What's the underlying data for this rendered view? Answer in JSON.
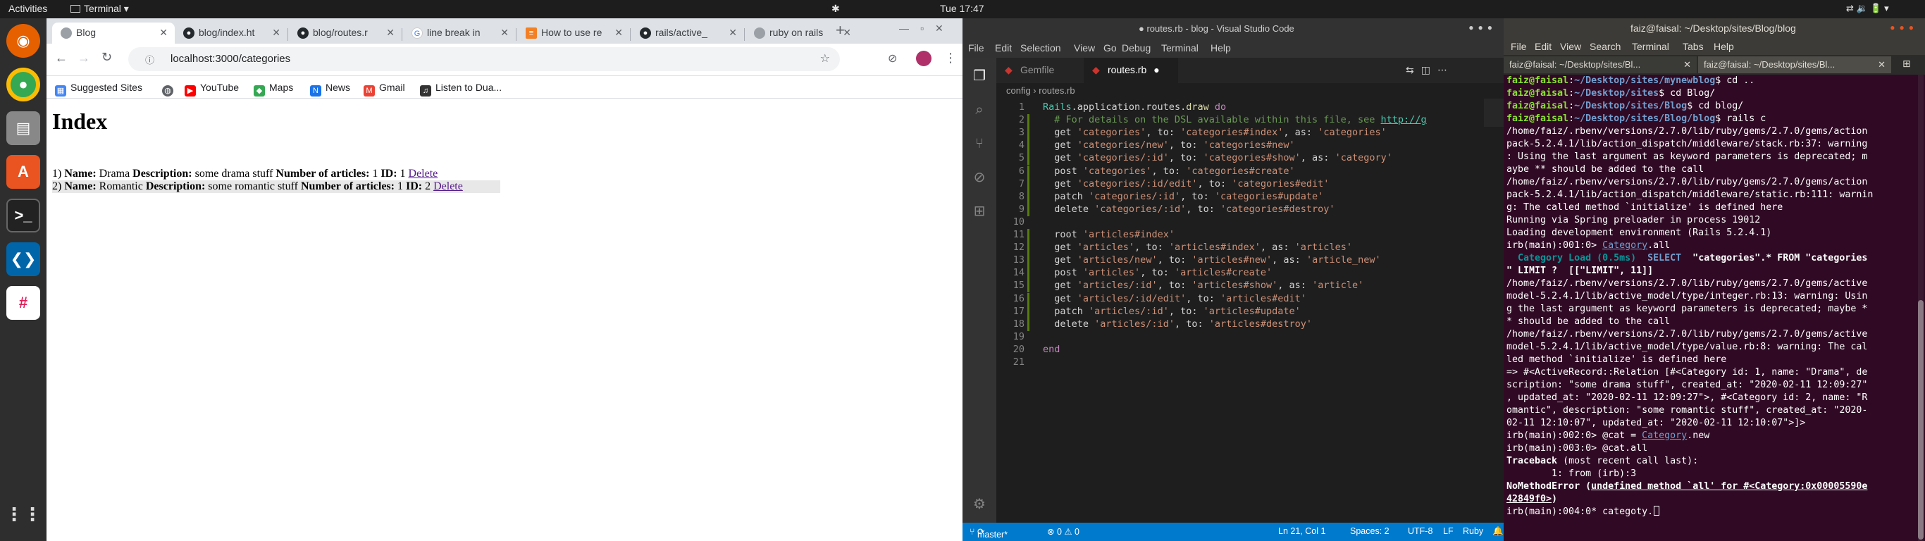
{
  "topbar": {
    "activities": "Activities",
    "app_menu": "Terminal ▾",
    "clock": "Tue 17:47"
  },
  "chrome": {
    "tabs": [
      {
        "title": "Blog",
        "active": true,
        "icon": "page-icon"
      },
      {
        "title": "blog/index.ht",
        "active": false,
        "icon": "github-icon"
      },
      {
        "title": "blog/routes.r",
        "active": false,
        "icon": "github-icon"
      },
      {
        "title": "line break in",
        "active": false,
        "icon": "google-icon"
      },
      {
        "title": "How to use re",
        "active": false,
        "icon": "stackoverflow-icon"
      },
      {
        "title": "rails/active_",
        "active": false,
        "icon": "github-icon"
      },
      {
        "title": "ruby on rails",
        "active": false,
        "icon": "page-icon"
      }
    ],
    "new_tab": "+",
    "url": "localhost:3000/categories",
    "bookmarks": [
      {
        "label": "Suggested Sites",
        "icon": "grid-icon"
      },
      {
        "label": "",
        "icon": "globe-icon"
      },
      {
        "label": "YouTube",
        "icon": "youtube-icon"
      },
      {
        "label": "Maps",
        "icon": "maps-icon"
      },
      {
        "label": "News",
        "icon": "news-icon"
      },
      {
        "label": "Gmail",
        "icon": "gmail-icon"
      },
      {
        "label": "Listen to Dua...",
        "icon": "dua-icon"
      }
    ]
  },
  "page": {
    "heading": "Index",
    "rows": [
      {
        "prefix": "1)",
        "name_label": "Name:",
        "name": "Drama",
        "desc_label": "Description:",
        "desc": "some drama stuff",
        "count_label": "Number of articles:",
        "count": "1",
        "id_label": "ID:",
        "id": "1",
        "delete": "Delete"
      },
      {
        "prefix": "2)",
        "name_label": "Name:",
        "name": "Romantic",
        "desc_label": "Description:",
        "desc": "some romantic stuff",
        "count_label": "Number of articles:",
        "count": "1",
        "id_label": "ID:",
        "id": "2",
        "delete": "Delete"
      }
    ]
  },
  "vscode": {
    "title": "● routes.rb - blog - Visual Studio Code",
    "menu": [
      "File",
      "Edit",
      "Selection",
      "View",
      "Go",
      "Debug",
      "Terminal",
      "Help"
    ],
    "tabs": [
      {
        "label": "Gemfile"
      },
      {
        "label": "routes.rb",
        "dirty": "●"
      }
    ],
    "breadcrumb": "config  ›  routes.rb",
    "status": {
      "branch": "master*",
      "problems": "⊗ 0  ⚠ 0",
      "position": "Ln 21, Col 1",
      "spaces": "Spaces: 2",
      "encoding": "UTF-8",
      "eol": "LF",
      "language": "Ruby"
    },
    "code_lines": [
      "Rails.application.routes.draw do",
      "  # For details on the DSL available within this file, see http://g",
      "  get 'categories', to: 'categories#index', as: 'categories'",
      "  get 'categories/new', to: 'categories#new'",
      "  get 'categories/:id', to: 'categories#show', as: 'category'",
      "  post 'categories', to: 'categories#create'",
      "  get 'categories/:id/edit', to: 'categories#edit'",
      "  patch 'categories/:id', to: 'categories#update'",
      "  delete 'categories/:id', to: 'categories#destroy'",
      "",
      "  root 'articles#index'",
      "  get 'articles', to: 'articles#index', as: 'articles'",
      "  get 'articles/new', to: 'articles#new', as: 'article_new'",
      "  post 'articles', to: 'articles#create'",
      "  get 'articles/:id', to: 'articles#show', as: 'article'",
      "  get 'articles/:id/edit', to: 'articles#edit'",
      "  patch 'articles/:id', to: 'articles#update'",
      "  delete 'articles/:id', to: 'articles#destroy'",
      "",
      "end",
      ""
    ]
  },
  "terminal": {
    "title": "faiz@faisal: ~/Desktop/sites/Blog/blog",
    "menu": [
      "File",
      "Edit",
      "View",
      "Search",
      "Terminal",
      "Tabs",
      "Help"
    ],
    "tabs": [
      "faiz@faisal: ~/Desktop/sites/Bl...",
      "faiz@faisal: ~/Desktop/sites/Bl..."
    ],
    "lines": [
      "faiz@faisal:~/Desktop/sites/mynewblog$ cd ..",
      "faiz@faisal:~/Desktop/sites$ cd Blog/",
      "faiz@faisal:~/Desktop/sites/Blog$ cd blog/",
      "faiz@faisal:~/Desktop/sites/Blog/blog$ rails c",
      "/home/faiz/.rbenv/versions/2.7.0/lib/ruby/gems/2.7.0/gems/action",
      "pack-5.2.4.1/lib/action_dispatch/middleware/stack.rb:37: warning",
      ": Using the last argument as keyword parameters is deprecated; m",
      "aybe ** should be added to the call",
      "/home/faiz/.rbenv/versions/2.7.0/lib/ruby/gems/2.7.0/gems/action",
      "pack-5.2.4.1/lib/action_dispatch/middleware/static.rb:111: warnin",
      "g: The called method `initialize' is defined here",
      "Running via Spring preloader in process 19012",
      "Loading development environment (Rails 5.2.4.1)",
      "irb(main):001:0> Category.all",
      "  Category Load (0.5ms)  SELECT  \"categories\".* FROM \"categories",
      "\" LIMIT ?  [[\"LIMIT\", 11]]",
      "/home/faiz/.rbenv/versions/2.7.0/lib/ruby/gems/2.7.0/gems/active",
      "model-5.2.4.1/lib/active_model/type/integer.rb:13: warning: Usin",
      "g the last argument as keyword parameters is deprecated; maybe *",
      "* should be added to the call",
      "/home/faiz/.rbenv/versions/2.7.0/lib/ruby/gems/2.7.0/gems/active",
      "model-5.2.4.1/lib/active_model/type/value.rb:8: warning: The cal",
      "led method `initialize' is defined here",
      "=> #<ActiveRecord::Relation [#<Category id: 1, name: \"Drama\", de",
      "scription: \"some drama stuff\", created_at: \"2020-02-11 12:09:27\"",
      ", updated_at: \"2020-02-11 12:09:27\">, #<Category id: 2, name: \"R",
      "omantic\", description: \"some romantic stuff\", created_at: \"2020-",
      "02-11 12:10:07\", updated_at: \"2020-02-11 12:10:07\">]>",
      "irb(main):002:0> @cat = Category.new",
      "irb(main):003:0> @cat.all",
      "Traceback (most recent call last):",
      "        1: from (irb):3",
      "NoMethodError (undefined method `all' for #<Category:0x00005590e",
      "42849f0>)",
      "irb(main):004:0* categoty."
    ]
  }
}
